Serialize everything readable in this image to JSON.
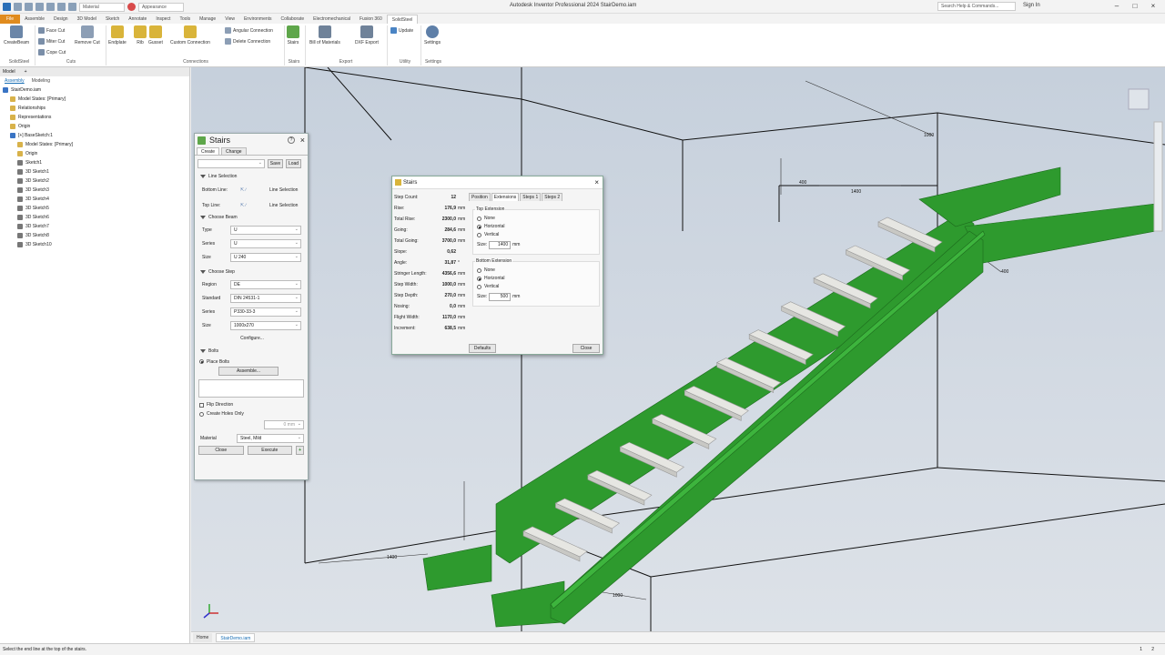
{
  "app": {
    "title": "Autodesk Inventor Professional 2024   StairDemo.iam",
    "quick_access": {
      "material": "Material",
      "appearance": "Appearance"
    },
    "search_placeholder": "Search Help & Commands...",
    "sign_in": "Sign In"
  },
  "ribbon_tabs": [
    "File",
    "Assemble",
    "Design",
    "3D Model",
    "Sketch",
    "Annotate",
    "Inspect",
    "Tools",
    "Manage",
    "View",
    "Environments",
    "Collaborate",
    "Electromechanical",
    "Fusion 360",
    "SolidSteel"
  ],
  "ribbon_active_tab": "SolidSteel",
  "ribbon": {
    "create_beam": "CreateBeam",
    "face_cut": "Face Cut",
    "miter_cut": "Miter Cut",
    "cope_cut": "Cope Cut",
    "remove_cut": "Remove Cut",
    "endplate": "Endplate",
    "rib": "Rib",
    "gusset": "Gusset",
    "custom_connection": "Custom Connection",
    "angular_connection": "Angular Connection",
    "delete_connection": "Delete Connection",
    "stairs": "Stairs",
    "bom": "Bill of Materials",
    "dxf": "DXF Export",
    "update": "Update",
    "settings": "Settings",
    "groups": {
      "solidsteel": "SolidSteel",
      "cuts": "Cuts",
      "connections": "Connections",
      "stairs": "Stairs",
      "export": "Export",
      "utility": "Utility",
      "settings": "Settings"
    }
  },
  "browser": {
    "header": "Model",
    "tabs": [
      "Assembly",
      "Modeling"
    ],
    "items": [
      {
        "label": "StairDemo.iam",
        "indent": 0,
        "color": "#3a74c4"
      },
      {
        "label": "Model States: [Primary]",
        "indent": 1,
        "color": "#d8b24a"
      },
      {
        "label": "Relationships",
        "indent": 1,
        "color": "#d8b24a"
      },
      {
        "label": "Representations",
        "indent": 1,
        "color": "#d8b24a"
      },
      {
        "label": "Origin",
        "indent": 1,
        "color": "#d8b24a"
      },
      {
        "label": "[+] BaseSketch:1",
        "indent": 1,
        "color": "#3a74c4"
      },
      {
        "label": "Model States: [Primary]",
        "indent": 2,
        "color": "#d8b24a"
      },
      {
        "label": "Origin",
        "indent": 2,
        "color": "#d8b24a"
      },
      {
        "label": "Sketch1",
        "indent": 2,
        "color": "#777"
      },
      {
        "label": "3D Sketch1",
        "indent": 2,
        "color": "#777"
      },
      {
        "label": "3D Sketch2",
        "indent": 2,
        "color": "#777"
      },
      {
        "label": "3D Sketch3",
        "indent": 2,
        "color": "#777"
      },
      {
        "label": "3D Sketch4",
        "indent": 2,
        "color": "#777"
      },
      {
        "label": "3D Sketch5",
        "indent": 2,
        "color": "#777"
      },
      {
        "label": "3D Sketch6",
        "indent": 2,
        "color": "#777"
      },
      {
        "label": "3D Sketch7",
        "indent": 2,
        "color": "#777"
      },
      {
        "label": "3D Sketch8",
        "indent": 2,
        "color": "#777"
      },
      {
        "label": "3D Sketch10",
        "indent": 2,
        "color": "#777"
      }
    ]
  },
  "stairs_dialog": {
    "title": "Stairs",
    "tabs": [
      "Create",
      "Change"
    ],
    "save": "Save",
    "load": "Load",
    "line_selection_header": "Line Selection",
    "bottom_line": "Bottom Line:",
    "top_line": "Top Line:",
    "line_selection": "Line Selection",
    "choose_beam_header": "Choose Beam",
    "type_label": "Type",
    "type_value": "U",
    "series_label": "Series",
    "series_value": "U",
    "size_label": "Size",
    "size_value": "U 240",
    "choose_step_header": "Choose Step",
    "region_label": "Region",
    "region_value": "DE",
    "standard_label": "Standard",
    "standard_value": "DIN 24531-1",
    "step_series_label": "Series",
    "step_series_value": "P330-33-3",
    "step_size_label": "Size",
    "step_size_value": "1000x270",
    "configure": "Configure...",
    "bolts_header": "Bolts",
    "place_bolts": "Place Bolts",
    "assemble": "Assemble...",
    "flip_direction": "Flip Direction",
    "create_holes_only": "Create Holes Only",
    "offset_value": "0 mm",
    "material_label": "Material",
    "material_value": "Steel, Mild",
    "close": "Close",
    "execute": "Execute"
  },
  "param_dialog": {
    "title": "Stairs",
    "params": [
      {
        "k": "Step Count:",
        "v": "12",
        "u": ""
      },
      {
        "k": "Rise:",
        "v": "176,9",
        "u": "mm"
      },
      {
        "k": "Total Rise:",
        "v": "2300,0",
        "u": "mm"
      },
      {
        "k": "Going:",
        "v": "284,6",
        "u": "mm"
      },
      {
        "k": "Total Going:",
        "v": "3700,0",
        "u": "mm"
      },
      {
        "k": "Slope:",
        "v": "0,62",
        "u": ""
      },
      {
        "k": "Angle:",
        "v": "31,87",
        "u": "°"
      },
      {
        "k": "Stringer Length:",
        "v": "4356,6",
        "u": "mm"
      },
      {
        "k": "Step Width:",
        "v": "1000,0",
        "u": "mm"
      },
      {
        "k": "Step Depth:",
        "v": "270,0",
        "u": "mm"
      },
      {
        "k": "Nosing:",
        "v": "0,0",
        "u": "mm"
      },
      {
        "k": "Flight Width:",
        "v": "1170,0",
        "u": "mm"
      },
      {
        "k": "Increment:",
        "v": "638,5",
        "u": "mm"
      }
    ],
    "tabs": [
      "Position",
      "Extensions",
      "Steps 1",
      "Steps 2"
    ],
    "active_tab": "Extensions",
    "top_ext": "Top Extension",
    "bottom_ext": "Bottom Extension",
    "none": "None",
    "horizontal": "Horizontal",
    "vertical": "Vertical",
    "size_label": "Size:",
    "top_size": "1400",
    "bottom_size": "500",
    "mm": "mm",
    "defaults": "Defaults",
    "close": "Close"
  },
  "viewport": {
    "dims": [
      "1000",
      "400",
      "1400",
      "400",
      "1400",
      "1000"
    ],
    "step_count": 12,
    "stringer_color": "#2e9a2e",
    "step_color": "#e6e6e2"
  },
  "doc_tabs": [
    "Home",
    "StairDemo.iam"
  ],
  "status": {
    "message": "Select the end line at the  top of the stairs.",
    "page1": "1",
    "page2": "2"
  }
}
